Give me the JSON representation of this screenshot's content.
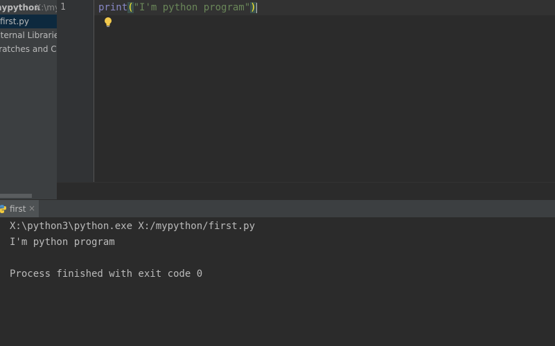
{
  "project_tree": {
    "root_name": "mypython",
    "root_path": "X:\\mypython",
    "file": "first.py",
    "external_libraries": "External Libraries",
    "scratches": "Scratches and Consoles"
  },
  "editor": {
    "line_number": "1",
    "code": {
      "function": "print",
      "open_paren": "(",
      "string": "\"I'm python program\"",
      "close_paren": ")"
    },
    "intention_icon": "lightbulb-icon"
  },
  "run_panel": {
    "tab_label": "first",
    "tab_icon": "python-icon",
    "close_glyph": "×",
    "console_lines": [
      "X:\\python3\\python.exe X:/mypython/first.py",
      "I'm python program",
      "",
      "Process finished with exit code 0"
    ]
  },
  "colors": {
    "background": "#2b2b2b",
    "panel": "#3c3f41",
    "selection": "#0d293e",
    "builtin": "#8888c6",
    "string": "#6a8759",
    "brace_match": "#ffef28"
  }
}
